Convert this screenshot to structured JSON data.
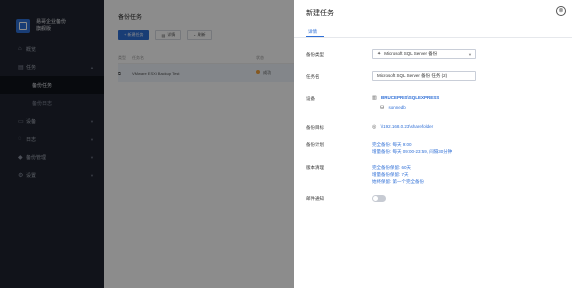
{
  "sidebar": {
    "brand_line1": "易哥企业备份",
    "brand_line2": "旗舰版",
    "items": [
      {
        "label": "概览",
        "icon": "home-icon"
      },
      {
        "label": "任务",
        "icon": "task-icon"
      },
      {
        "label": "设备",
        "icon": "device-icon"
      },
      {
        "label": "日志",
        "icon": "log-icon"
      },
      {
        "label": "备份管理",
        "icon": "storage-icon"
      },
      {
        "label": "设置",
        "icon": "settings-icon"
      }
    ],
    "sub_items": [
      "备份任务",
      "备份日志"
    ]
  },
  "main": {
    "title": "备份任务",
    "btn_new": "+ 新建任务",
    "btn_detail": "详情",
    "btn_refresh": "刷新",
    "columns": [
      "类型",
      "任务名",
      "",
      "状态"
    ],
    "row": {
      "name": "VMware ESXi Backup Test",
      "status": "成功"
    }
  },
  "drawer": {
    "title": "新建任务",
    "close": "⊗",
    "tab": "详情",
    "fields": {
      "type_label": "备份类型",
      "type_value": "Microsoft SQL Server 备份",
      "name_label": "任务名",
      "name_value": "Microsoft SQL Server 备份 任务 (2)",
      "device_label": "设备",
      "device_name": "BRUCEPRIS\\SQLEXPRESS",
      "device_sub": "sonnedb",
      "target_label": "备份目标",
      "target_value": "\\\\192.168.0.23\\sharefolder",
      "schedule_label": "备份计划",
      "schedule_line1": "完全备份: 每天 9:00",
      "schedule_line2": "增量备份: 每天 09:00-23:59, 间隔30分钟",
      "retention_label": "版本清理",
      "retention_line1": "完全备份保留: 60天",
      "retention_line2": "增量备份保留: 7天",
      "retention_line3": "始终保留: 第一个完全备份",
      "email_label": "邮件通知"
    }
  },
  "colors": {
    "accent": "#2f6fd6",
    "sidebar_bg": "#1f2430"
  }
}
